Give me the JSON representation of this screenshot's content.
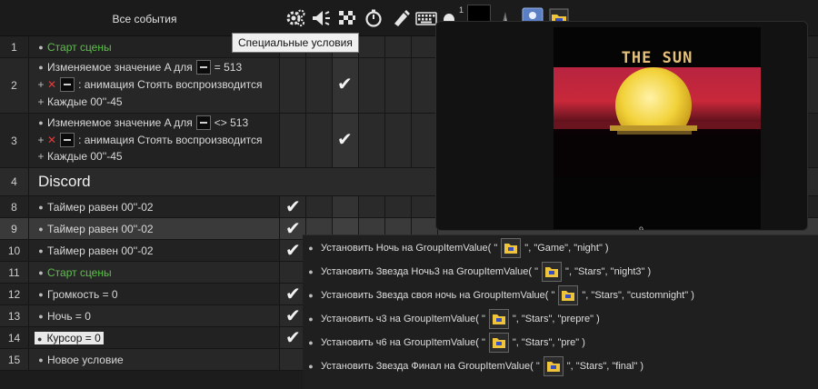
{
  "header": {
    "title": "Все события",
    "superscript": "1",
    "icons": [
      "system-gear-icon",
      "speaker-icon",
      "checker-flag-icon",
      "timer-icon",
      "pen-icon",
      "keyboard-icon",
      "mouse-icon",
      "black-object-icon",
      "shadow-object-icon",
      "blue-object-icon",
      "folder-object-icon"
    ]
  },
  "tooltip": {
    "text": "Специальные условия"
  },
  "rows": [
    {
      "num": "1",
      "lines": [
        {
          "prefix": "bullet",
          "text": "Старт сцены",
          "color": "#5cc04a"
        }
      ]
    },
    {
      "num": "2",
      "lines": [
        {
          "prefix": "bullet",
          "text_before": "Изменяемое значение A для",
          "text_after": "= 513"
        },
        {
          "prefix": "plus",
          "negated": true,
          "text": ": анимация Стоять воспроизводится"
        },
        {
          "prefix": "plus",
          "text": "Каждые 00''-45"
        }
      ]
    },
    {
      "num": "3",
      "lines": [
        {
          "prefix": "bullet",
          "text_before": "Изменяемое значение A для",
          "text_after": "<> 513"
        },
        {
          "prefix": "plus",
          "negated": true,
          "text": ": анимация Стоять воспроизводится"
        },
        {
          "prefix": "plus",
          "text": "Каждые 00''-45"
        }
      ]
    },
    {
      "num": "4",
      "section_title": "Discord"
    },
    {
      "num": "8",
      "lines": [
        {
          "prefix": "bullet",
          "text": "Таймер равен 00''-02"
        }
      ]
    },
    {
      "num": "9",
      "lines": [
        {
          "prefix": "bullet",
          "text": "Таймер равен 00''-02"
        }
      ]
    },
    {
      "num": "10",
      "lines": [
        {
          "prefix": "bullet",
          "text": "Таймер равен 00''-02"
        }
      ]
    },
    {
      "num": "11",
      "lines": [
        {
          "prefix": "bullet",
          "text": "Старт сцены",
          "color": "#5cc04a"
        }
      ]
    },
    {
      "num": "12",
      "lines": [
        {
          "prefix": "bullet",
          "text": "Громкость = 0"
        }
      ]
    },
    {
      "num": "13",
      "lines": [
        {
          "prefix": "bullet",
          "text": "Ночь = 0"
        }
      ]
    },
    {
      "num": "14",
      "lines": [
        {
          "prefix": "bullet",
          "text": "Курсор = 0",
          "selected": true
        }
      ]
    },
    {
      "num": "15",
      "lines": [
        {
          "prefix": "bullet",
          "text": "Новое условие"
        }
      ]
    }
  ],
  "preview": {
    "title": "THE SUN",
    "counter": "9"
  },
  "actions": [
    {
      "before": "Установить Ночь на GroupItemValue( \"",
      "after": "\", \"Game\", \"night\" )"
    },
    {
      "before": "Установить Звезда Ночь3 на GroupItemValue( \"",
      "after": "\", \"Stars\", \"night3\" )"
    },
    {
      "before": "Установить Звезда своя ночь на GroupItemValue( \"",
      "after": "\", \"Stars\", \"customnight\" )"
    },
    {
      "before": "Установить ч3 на GroupItemValue( \"",
      "after": "\", \"Stars\", \"prepre\" )"
    },
    {
      "before": "Установить ч6 на GroupItemValue( \"",
      "after": "\", \"Stars\", \"pre\" )"
    },
    {
      "before": "Установить Звезда Финал на GroupItemValue( \"",
      "after": "\", \"Stars\", \"final\" )"
    }
  ],
  "colors": {
    "accent_green": "#5cc04a",
    "negation_red": "#e33b3b",
    "sun_yellow": "#f2d23a",
    "sunset_red": "#c8283a"
  }
}
